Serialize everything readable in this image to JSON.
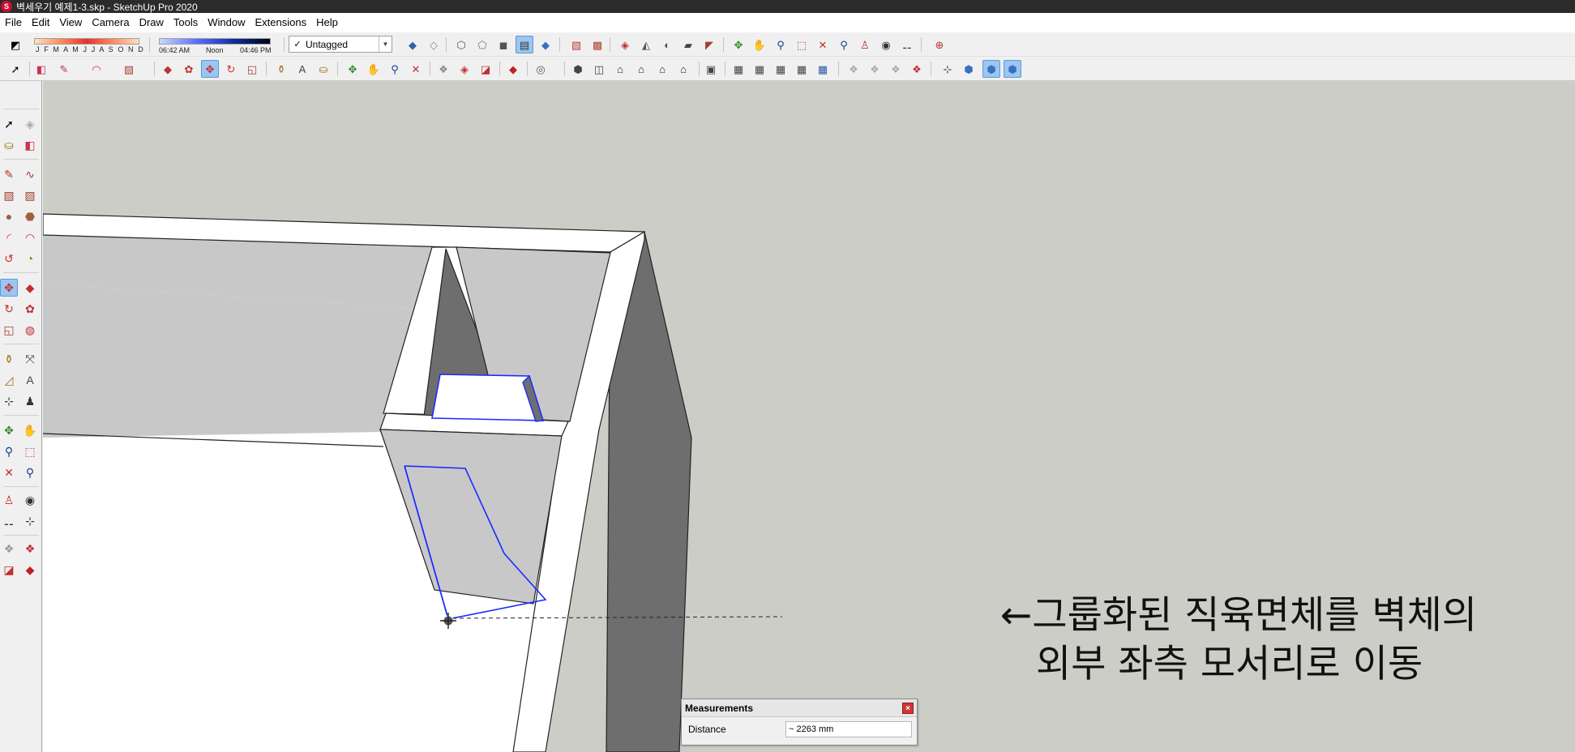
{
  "window": {
    "title": "벽세우기 예제1-3.skp - SketchUp Pro 2020"
  },
  "menu": {
    "items": [
      "File",
      "Edit",
      "View",
      "Camera",
      "Draw",
      "Tools",
      "Window",
      "Extensions",
      "Help"
    ]
  },
  "shadows": {
    "months_label": "J F M A M J J A S O N D",
    "time_start": "06:42 AM",
    "time_noon": "Noon",
    "time_end": "04:46 PM"
  },
  "tag": {
    "selected": "Untagged"
  },
  "annotation": {
    "line1": "←그룹화된 직육면체를 벽체의",
    "line2": "외부 좌측 모서리로 이동"
  },
  "measurements": {
    "title": "Measurements",
    "label": "Distance",
    "value": "~ 2263 mm"
  },
  "colors": {
    "viewport_bg": "#cdcdc8",
    "selection": "#1a2cff",
    "wall_top": "#ffffff",
    "wall_dark": "#6e6e6e",
    "wall_mid": "#c8c8c8"
  }
}
